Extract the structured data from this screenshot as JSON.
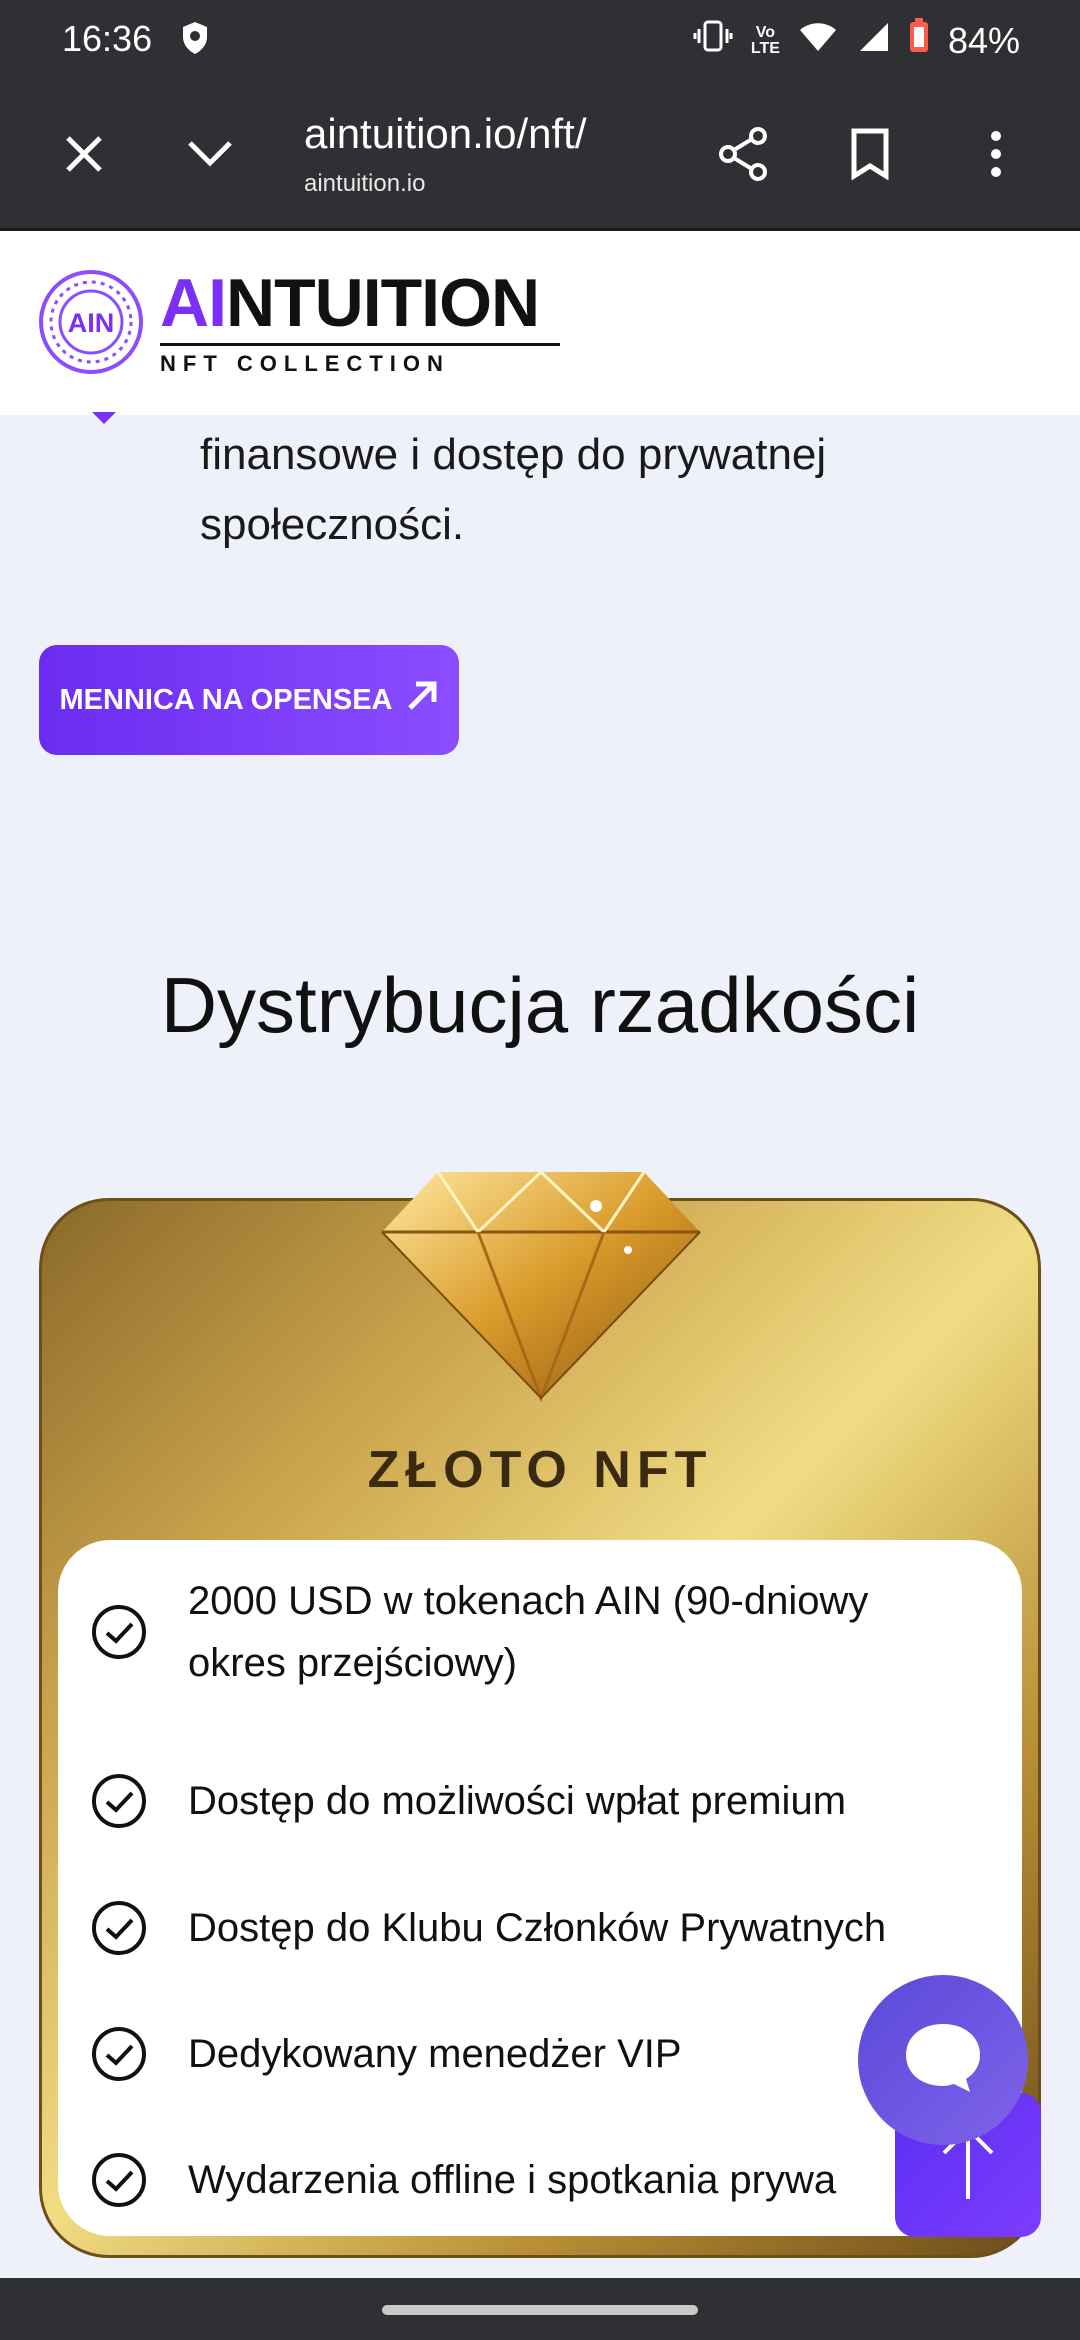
{
  "status_bar": {
    "time": "16:36",
    "battery": "84%",
    "network_label_top": "Vo",
    "network_label_bottom": "LTE",
    "icons": [
      "shield-icon",
      "vibrate-icon",
      "wifi-icon",
      "signal-icon",
      "battery-icon"
    ]
  },
  "browser": {
    "url": "aintuition.io/nft/",
    "domain": "aintuition.io",
    "icons": [
      "close-icon",
      "chevron-down-icon",
      "share-icon",
      "bookmark-icon",
      "more-vert-icon"
    ]
  },
  "site": {
    "logo_badge": "AIN",
    "logo_title_accent": "AI",
    "logo_title_rest": "NTUITION",
    "logo_subtitle": "NFT COLLECTION"
  },
  "intro": {
    "text": "finansowe i dostęp do prywatnej społeczności."
  },
  "mint_button": {
    "label": "MENNICA NA OPENSEA"
  },
  "section": {
    "title": "Dystrybucja rzadkości"
  },
  "card": {
    "title": "ZŁOTO NFT",
    "features": [
      {
        "line1": "2000 USD w tokenach AIN (90-dniowy",
        "line2": "okres przejściowy)"
      },
      {
        "line1": "Dostęp do możliwości wpłat premium"
      },
      {
        "line1": "Dostęp do Klubu Członków Prywatnych"
      },
      {
        "line1": "Dedykowany menedżer VIP"
      },
      {
        "line1": "Wydarzenia offline i spotkania prywa"
      }
    ]
  },
  "colors": {
    "brand_purple": "#7b2ff7",
    "gold": "#e8c86a",
    "chrome_dark": "#2f3033"
  }
}
